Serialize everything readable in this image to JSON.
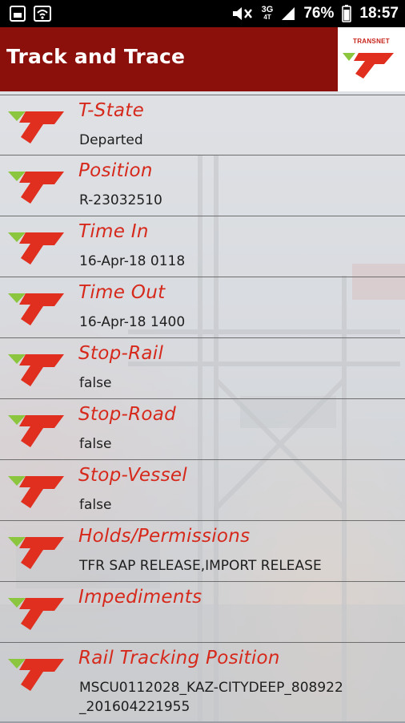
{
  "status_bar": {
    "icons_left": [
      "gallery-icon",
      "wifi-icon"
    ],
    "network": "3G",
    "network_sub": "4T",
    "battery_percent": "76%",
    "time": "18:57"
  },
  "app_bar": {
    "title": "Track and Trace",
    "logo_text": "TRANSNET"
  },
  "items": [
    {
      "label": "T-State",
      "value": "Departed"
    },
    {
      "label": "Position",
      "value": "R-23032510"
    },
    {
      "label": "Time In",
      "value": "16-Apr-18 0118"
    },
    {
      "label": "Time Out",
      "value": "16-Apr-18 1400"
    },
    {
      "label": "Stop-Rail",
      "value": "false"
    },
    {
      "label": "Stop-Road",
      "value": "false"
    },
    {
      "label": "Stop-Vessel",
      "value": "false"
    },
    {
      "label": "Holds/Permissions",
      "value": "TFR SAP RELEASE,IMPORT RELEASE"
    },
    {
      "label": "Impediments",
      "value": ""
    },
    {
      "label": "Rail Tracking Position",
      "value": "MSCU0112028_KAZ-CITYDEEP_808922_201604221955"
    }
  ],
  "colors": {
    "app_bar": "#8b0f0b",
    "label": "#d6291c",
    "logo_red": "#e02f1f",
    "logo_green": "#8cc63f"
  }
}
